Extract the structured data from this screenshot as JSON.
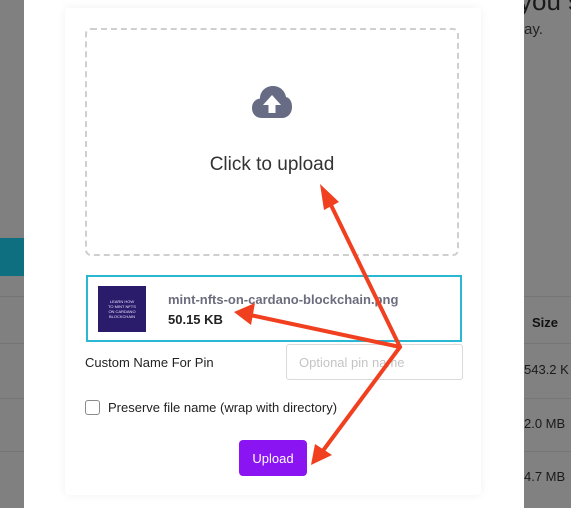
{
  "background": {
    "heading_fragment": "you s",
    "sub_fragment": "ay.",
    "table": {
      "size_header": "Size",
      "sizes": [
        "543.2 K",
        "2.0 MB",
        "4.7 MB"
      ]
    },
    "accent": "#0d6f80"
  },
  "modal": {
    "dropzone": {
      "icon": "cloud-upload-icon",
      "text": "Click to upload"
    },
    "file": {
      "thumbnail_text": "LEARN HOW TO MINT NFTS ON CARDANO BLOCKCHAIN",
      "name": "mint-nfts-on-cardano-blockchain.png",
      "size": "50.15 KB",
      "highlight_color": "#29b7d1"
    },
    "custom_name": {
      "label": "Custom Name For Pin",
      "placeholder": "Optional pin name",
      "value": ""
    },
    "preserve": {
      "label": "Preserve file name (wrap with directory)",
      "checked": false
    },
    "upload_button": {
      "label": "Upload",
      "color": "#8b14f2"
    }
  },
  "annotation": {
    "arrow_color": "#f0401f"
  }
}
